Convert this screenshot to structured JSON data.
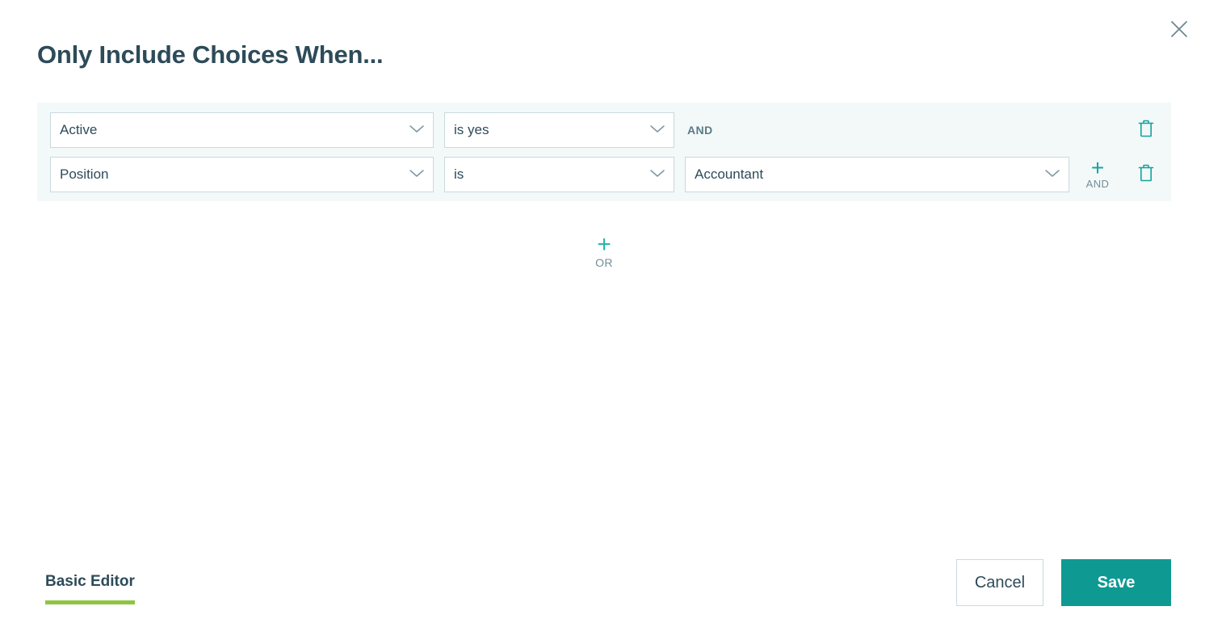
{
  "dialog": {
    "title": "Only Include Choices When...",
    "close_icon": "close-icon"
  },
  "colors": {
    "accent_teal": "#0e9a93",
    "icon_teal": "#18a4a0",
    "title_slate": "#2d4b59",
    "group_background": "#f3f8f9",
    "input_border": "#c9d9de",
    "underline_green": "#8cc640",
    "muted_text": "#748e99"
  },
  "condition_group": {
    "rows": [
      {
        "field": "Active",
        "operator": "is yes",
        "value": null,
        "conjunction": "AND",
        "has_add_button": false,
        "delete_icon": "trash-icon",
        "chevron_icon": "chevron-down-icon"
      },
      {
        "field": "Position",
        "operator": "is",
        "value": "Accountant",
        "conjunction": null,
        "has_add_button": true,
        "add_label": "AND",
        "add_icon": "plus-icon",
        "delete_icon": "trash-icon",
        "chevron_icon": "chevron-down-icon"
      }
    ]
  },
  "add_or": {
    "label": "OR",
    "icon": "plus-icon"
  },
  "footer": {
    "editor_toggle_label": "Basic Editor",
    "cancel_label": "Cancel",
    "save_label": "Save"
  }
}
